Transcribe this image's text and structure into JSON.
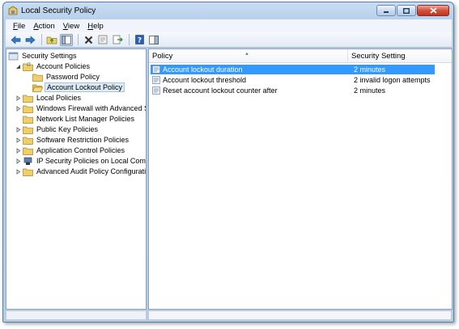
{
  "window": {
    "title": "Local Security Policy",
    "accent": "#3399ff"
  },
  "menu": {
    "items": [
      {
        "first": "F",
        "rest": "ile"
      },
      {
        "first": "A",
        "rest": "ction"
      },
      {
        "first": "V",
        "rest": "iew"
      },
      {
        "first": "H",
        "rest": "elp"
      }
    ]
  },
  "toolbar": {
    "icons": [
      "back-arrow-icon",
      "forward-arrow-icon",
      "up-folder-icon",
      "show-hide-tree-icon",
      "delete-icon",
      "properties-icon",
      "export-list-icon",
      "help-icon",
      "action-pane-icon"
    ]
  },
  "tree": {
    "root": "Security Settings",
    "account_policies": "Account Policies",
    "password_policy": "Password Policy",
    "account_lockout_policy": "Account Lockout Policy",
    "local_policies": "Local Policies",
    "firewall": "Windows Firewall with Advanced Secu",
    "network_list": "Network List Manager Policies",
    "public_key": "Public Key Policies",
    "software_restriction": "Software Restriction Policies",
    "application_control": "Application Control Policies",
    "ip_security": "IP Security Policies on Local Compute",
    "advanced_audit": "Advanced Audit Policy Configuration"
  },
  "list": {
    "col_policy": "Policy",
    "col_setting": "Security Setting",
    "rows": [
      {
        "policy": "Account lockout duration",
        "setting": "2 minutes"
      },
      {
        "policy": "Account lockout threshold",
        "setting": "2 invalid logon attempts"
      },
      {
        "policy": "Reset account lockout counter after",
        "setting": "2 minutes"
      }
    ]
  }
}
